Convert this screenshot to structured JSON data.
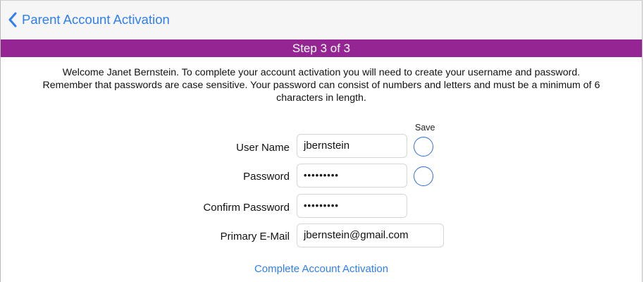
{
  "nav": {
    "back_title": "Parent Account Activation",
    "accent": "#2f7ff4"
  },
  "step_bar": {
    "label": "Step 3 of 3",
    "color": "#962594"
  },
  "welcome": {
    "line1": "Welcome Janet Bernstein. To complete your account activation you will need to create your username and password.",
    "line2": "Remember that passwords are case sensitive. Your password can consist of numbers and letters and must be a minimum of 6",
    "line3": "characters in length."
  },
  "form": {
    "save_label": "Save",
    "username": {
      "label": "User Name",
      "value": "jbernstein"
    },
    "password": {
      "label": "Password",
      "value": "•••••••••"
    },
    "confirm_password": {
      "label": "Confirm Password",
      "value": "•••••••••"
    },
    "email": {
      "label": "Primary E-Mail",
      "value": "jbernstein@gmail.com"
    }
  },
  "actions": {
    "complete_label": "Complete Account Activation"
  }
}
